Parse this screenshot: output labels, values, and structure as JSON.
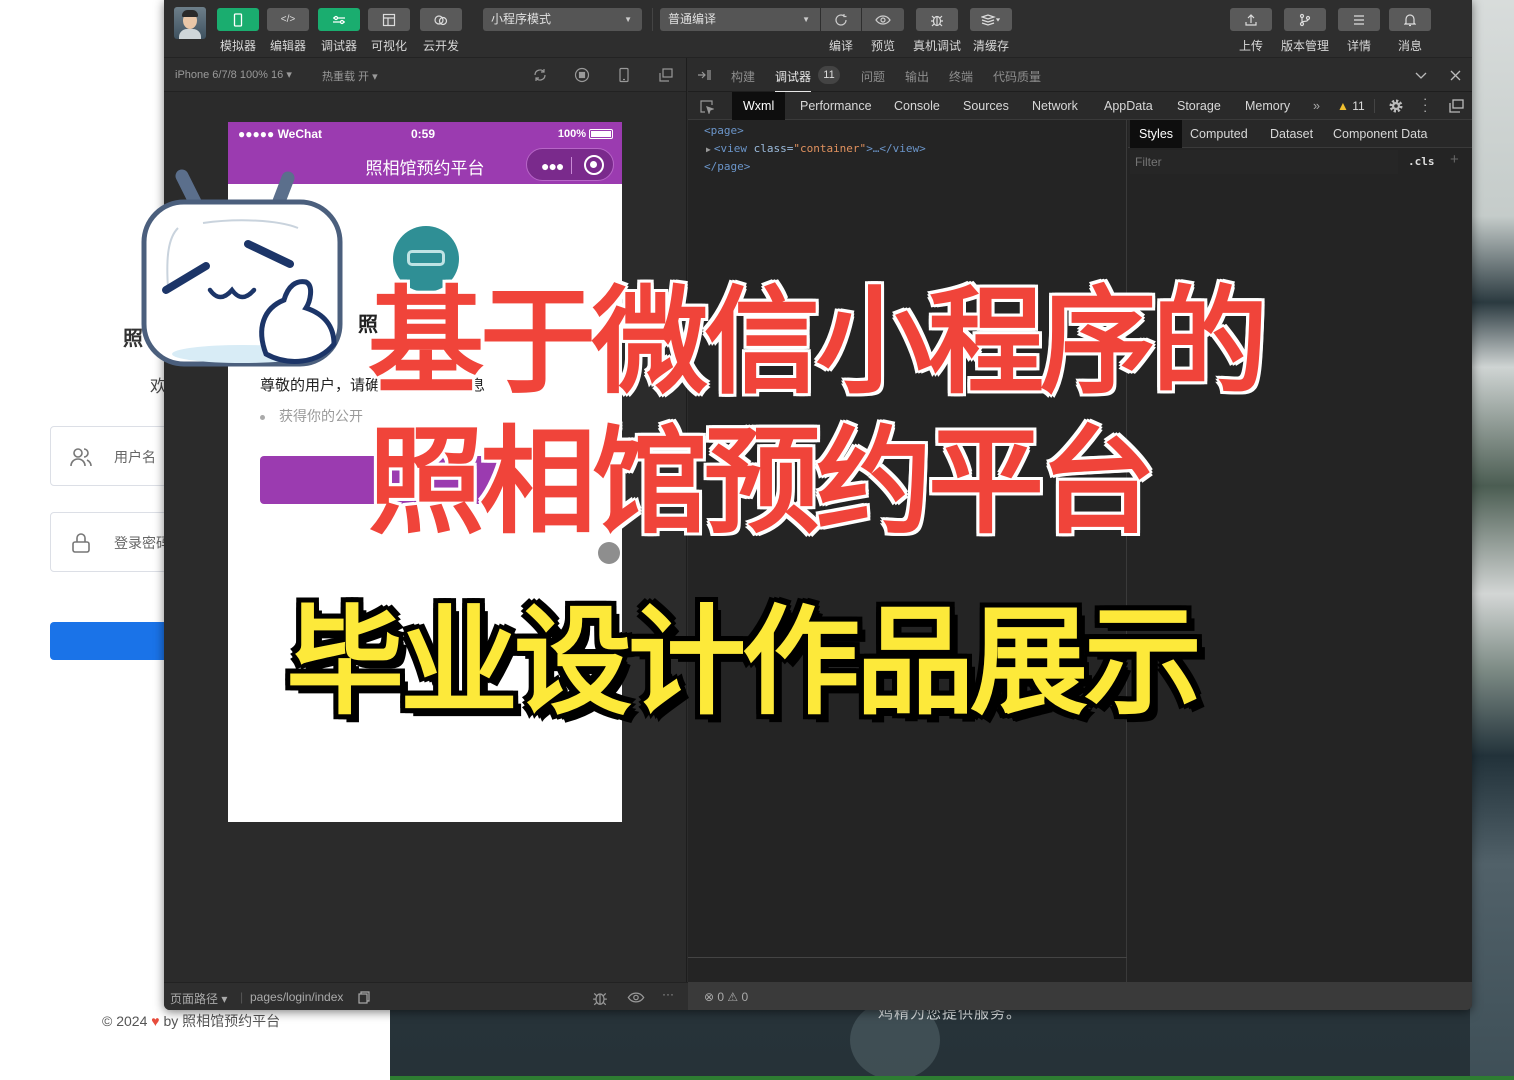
{
  "background_page": {
    "title_partial": "照",
    "welcome_partial": "欢",
    "username_placeholder": "用户名",
    "password_placeholder": "登录密码",
    "footer": {
      "copyright": "© 2024",
      "by": "by 照相馆预约平台"
    },
    "right_caption_partial": "鸡精为您提供服务。"
  },
  "toolbar": {
    "left_buttons": [
      {
        "label": "模拟器",
        "icon": "phone-icon",
        "active": true
      },
      {
        "label": "编辑器",
        "icon": "code-icon",
        "active": false
      },
      {
        "label": "调试器",
        "icon": "sliders-icon",
        "active": true
      },
      {
        "label": "可视化",
        "icon": "layout-icon",
        "active": false
      },
      {
        "label": "云开发",
        "icon": "cloud-icon",
        "active": false
      }
    ],
    "mode_select": "小程序模式",
    "compile_select": "普通编译",
    "mid_buttons": [
      {
        "label": "编译",
        "icon": "refresh-icon"
      },
      {
        "label": "预览",
        "icon": "eye-icon"
      },
      {
        "label": "真机调试",
        "icon": "bug-icon"
      },
      {
        "label": "清缓存",
        "icon": "layers-icon"
      }
    ],
    "right_buttons": [
      {
        "label": "上传",
        "icon": "upload-icon"
      },
      {
        "label": "版本管理",
        "icon": "branch-icon"
      },
      {
        "label": "详情",
        "icon": "menu-icon"
      },
      {
        "label": "消息",
        "icon": "bell-icon"
      }
    ]
  },
  "simulator": {
    "device": "iPhone 6/7/8 100% 16",
    "hot_reload": "热重载 开",
    "status_bar": {
      "carrier": "●●●●● WeChat",
      "time": "0:59",
      "battery": "100%"
    },
    "nav_title": "照相馆预约平台",
    "page_title_partial": "照",
    "auth_text": "尊敬的用户，请确认授权以下信息",
    "auth_item": "获得你的公开",
    "footer": {
      "path_label": "页面路径",
      "path": "pages/login/index"
    }
  },
  "debugger": {
    "top_tabs": [
      {
        "label": "构建",
        "active": false
      },
      {
        "label": "调试器",
        "active": true,
        "badge": "11"
      },
      {
        "label": "问题",
        "active": false
      },
      {
        "label": "输出",
        "active": false
      },
      {
        "label": "终端",
        "active": false
      },
      {
        "label": "代码质量",
        "active": false
      }
    ],
    "panel_tabs": [
      {
        "label": "Wxml",
        "active": true
      },
      {
        "label": "Performance",
        "active": false
      },
      {
        "label": "Console",
        "active": false
      },
      {
        "label": "Sources",
        "active": false
      },
      {
        "label": "Network",
        "active": false
      },
      {
        "label": "AppData",
        "active": false
      },
      {
        "label": "Storage",
        "active": false
      },
      {
        "label": "Memory",
        "active": false
      }
    ],
    "more": "»",
    "warning_count": "11",
    "wxml": {
      "line1": "<page>",
      "line2_tag_open": "<view ",
      "line2_attr": "class=",
      "line2_value": "\"container\"",
      "line2_rest": ">…</view>",
      "line3": "</page>"
    },
    "style_tabs": [
      {
        "label": "Styles",
        "active": true
      },
      {
        "label": "Computed",
        "active": false
      },
      {
        "label": "Dataset",
        "active": false
      },
      {
        "label": "Component Data",
        "active": false
      }
    ],
    "filter_placeholder": "Filter",
    "cls_label": ".cls",
    "plus": "+",
    "status": "⊗ 0 ⚠ 0"
  },
  "overlay": {
    "line1": "基于微信小程序的",
    "line2": "照相馆预约平台",
    "line3": "毕业设计作品展示",
    "colors": {
      "red": "#f0443a",
      "yellow": "#fde93a",
      "purple": "#9b3bb0"
    }
  }
}
